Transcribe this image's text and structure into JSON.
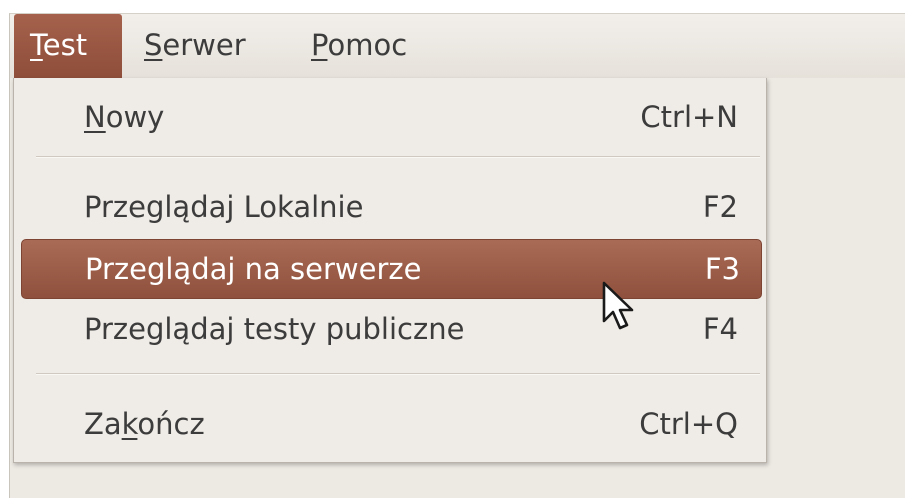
{
  "menubar": {
    "items": [
      {
        "mnemonic": "T",
        "rest": "est"
      },
      {
        "mnemonic": "S",
        "rest": "erwer"
      },
      {
        "mnemonic": "P",
        "rest": "omoc"
      }
    ]
  },
  "menu": {
    "nowy": {
      "pre": "",
      "mnemonic": "N",
      "post": "owy",
      "accel": "Ctrl+N"
    },
    "local": {
      "label": "Przeglądaj Lokalnie",
      "accel": "F2"
    },
    "server": {
      "label": "Przeglądaj na serwerze",
      "accel": "F3"
    },
    "public": {
      "label": "Przeglądaj testy publiczne",
      "accel": "F4"
    },
    "quit": {
      "pre": "Za",
      "mnemonic": "k",
      "post": "ończ",
      "accel": "Ctrl+Q"
    }
  },
  "colors": {
    "accent": "#9a5743",
    "menu_bg": "#efebe6",
    "window_bg": "#ede9e3"
  },
  "icons": {
    "cursor": "mouse-pointer-icon"
  }
}
